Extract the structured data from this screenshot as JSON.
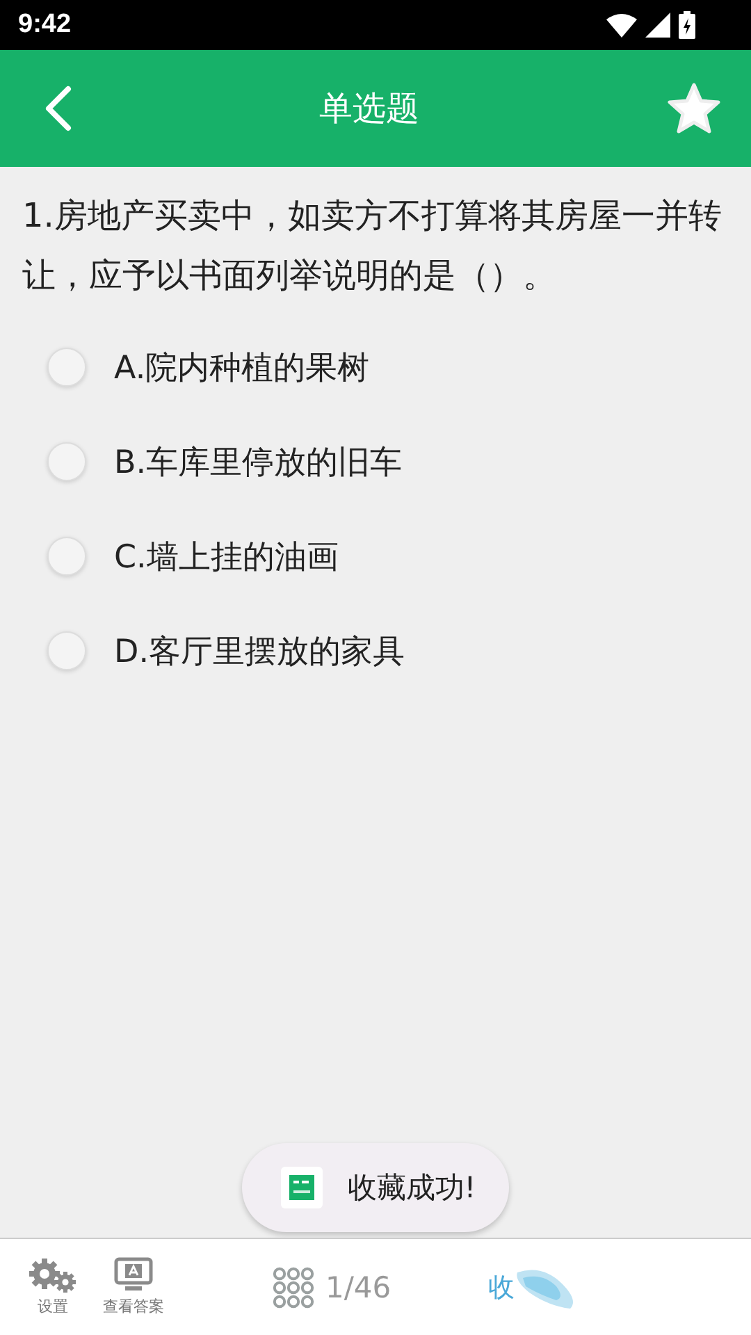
{
  "status_bar": {
    "time": "9:42"
  },
  "header": {
    "title": "单选题",
    "favorited": true
  },
  "question": {
    "text": "1.房地产买卖中，如卖方不打算将其房屋一并转让，应予以书面列举说明的是（）。",
    "options": [
      {
        "label": "A.院内种植的果树",
        "selected": false
      },
      {
        "label": "B.车库里停放的旧车",
        "selected": false
      },
      {
        "label": "C.墙上挂的油画",
        "selected": false
      },
      {
        "label": "D.客厅里摆放的家具",
        "selected": false
      }
    ]
  },
  "toast": {
    "text": "收藏成功!"
  },
  "bottom_bar": {
    "settings": "设置",
    "view_answer": "查看答案",
    "progress": "1/46",
    "favorite": "收"
  }
}
